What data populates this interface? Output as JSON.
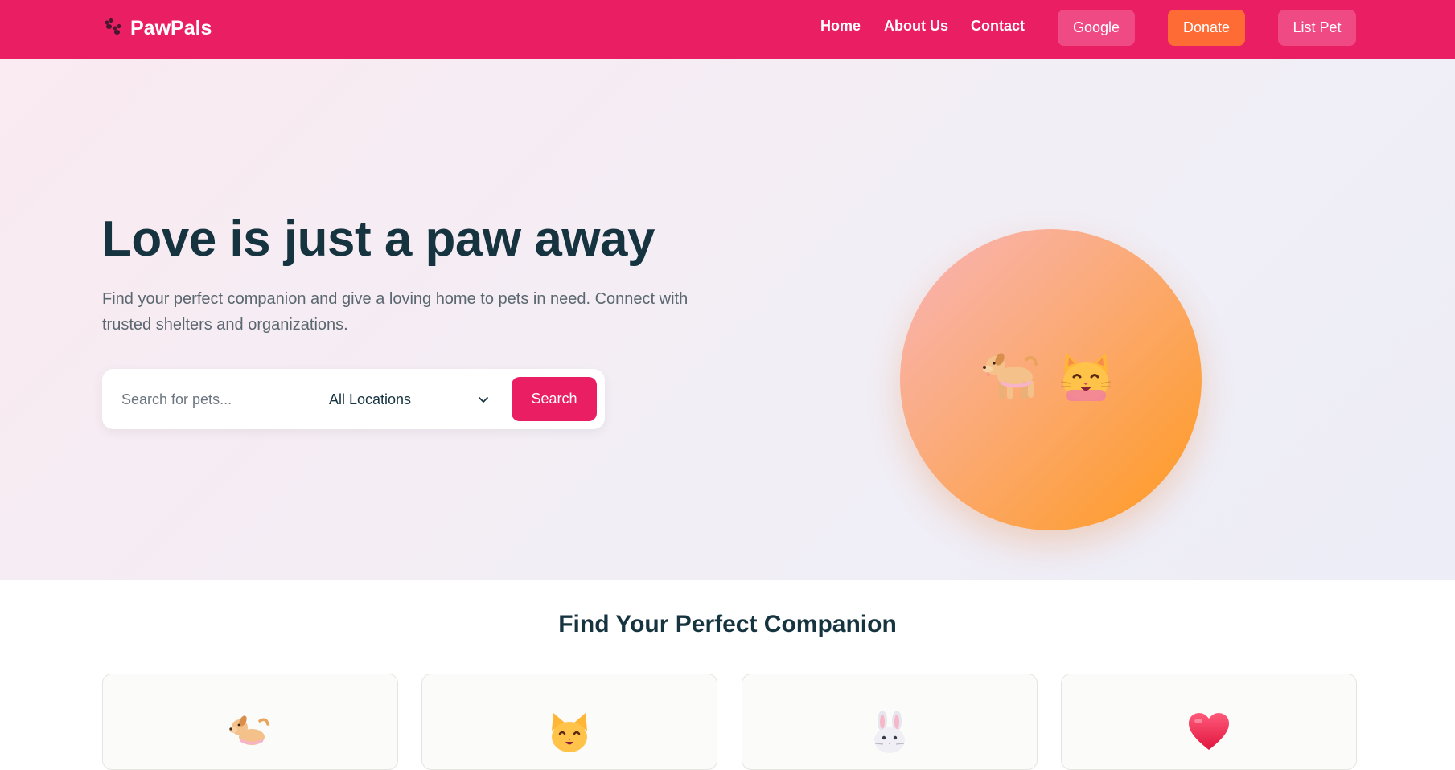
{
  "brand": {
    "name": "PawPals",
    "icon": "paw-prints-icon"
  },
  "nav": {
    "links": [
      "Home",
      "About Us",
      "Contact"
    ],
    "google_label": "Google",
    "donate_label": "Donate",
    "list_pet_label": "List Pet"
  },
  "hero": {
    "title": "Love is just a paw away",
    "subtitle": "Find your perfect companion and give a loving home to pets in need. Connect with trusted shelters and organizations.",
    "search": {
      "placeholder": "Search for pets...",
      "location_selected": "All Locations",
      "button_label": "Search"
    },
    "illustration_icons": [
      "dog-icon",
      "cat-face-icon"
    ]
  },
  "categories": {
    "title": "Find Your Perfect Companion",
    "cards": [
      {
        "icon": "dog-icon"
      },
      {
        "icon": "cat-face-icon"
      },
      {
        "icon": "rabbit-icon"
      },
      {
        "icon": "heart-icon"
      }
    ]
  },
  "colors": {
    "primary": "#ea1e63",
    "accent_orange": "#ff6b35",
    "heading": "#163340",
    "body_text": "#5b6770"
  }
}
